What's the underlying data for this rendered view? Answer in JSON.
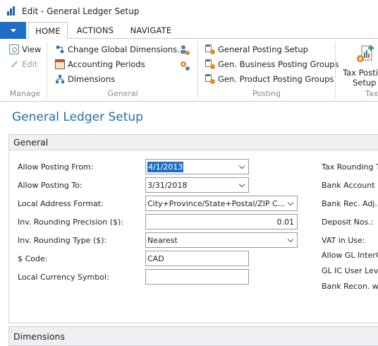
{
  "window": {
    "title": "Edit - General Ledger Setup"
  },
  "ribbon": {
    "tabs": {
      "home": "HOME",
      "actions": "ACTIONS",
      "navigate": "NAVIGATE"
    },
    "manage": {
      "view": "View",
      "edit": "Edit",
      "label": "Manage"
    },
    "general": {
      "change_dims": "Change Global Dimensions...",
      "acct_periods": "Accounting Periods",
      "dimensions": "Dimensions",
      "label": "General"
    },
    "posting": {
      "gen_posting_setup": "General Posting Setup",
      "gen_bus_groups": "Gen. Business Posting Groups",
      "gen_prod_groups": "Gen. Product Posting Groups",
      "label": "Posting"
    },
    "tax": {
      "tax_posting_setup_line1": "Tax Postin",
      "tax_posting_setup_line2": "Setup",
      "label": "Tax"
    }
  },
  "page": {
    "title": "General Ledger Setup"
  },
  "general_tab": {
    "header": "General",
    "fields": {
      "allow_from": {
        "label": "Allow Posting From:",
        "value": "4/1/2013"
      },
      "allow_to": {
        "label": "Allow Posting To:",
        "value": "3/31/2018"
      },
      "local_addr": {
        "label": "Local Address Format:",
        "value": "City+Province/State+Postal/ZIP C..."
      },
      "inv_round_prec": {
        "label": "Inv. Rounding Precision ($):",
        "value": "0.01"
      },
      "inv_round_type": {
        "label": "Inv. Rounding Type ($):",
        "value": "Nearest"
      },
      "code": {
        "label": "$ Code:",
        "value": "CAD"
      },
      "local_currency": {
        "label": "Local Currency Symbol:",
        "value": ""
      }
    },
    "right_labels": {
      "tax_rounding": "Tax Rounding T",
      "bank_account": "Bank Account N",
      "bank_rec_adj": "Bank Rec. Adj. I",
      "deposit_nos": "Deposit Nos.:",
      "vat_in_use": "VAT in Use:",
      "allow_gl_inter": "Allow GL InterC",
      "gl_ic_user": "GL IC User Leve",
      "bank_recon": "Bank Recon. wi"
    }
  },
  "dimensions_tab": {
    "header": "Dimensions"
  },
  "colors": {
    "accent": "#1e6fc4",
    "title": "#1f6fb4"
  }
}
